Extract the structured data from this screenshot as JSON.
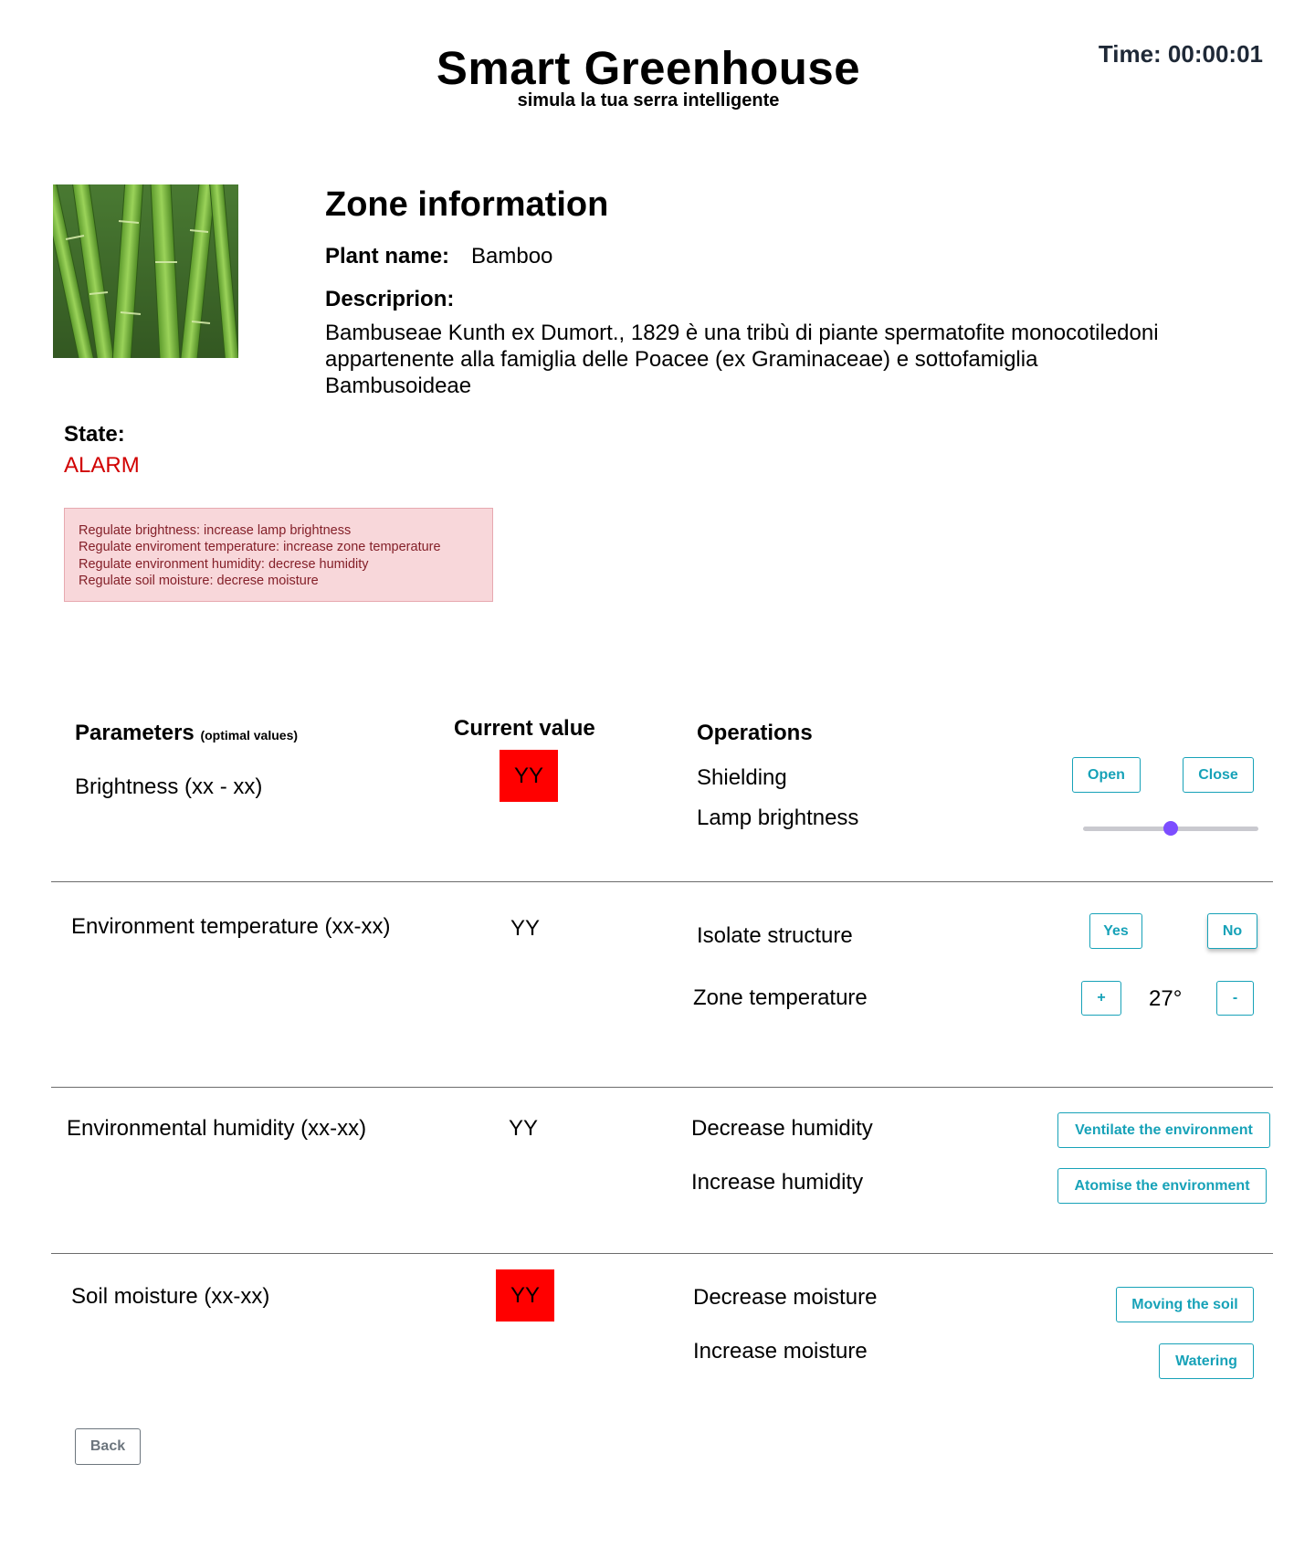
{
  "header": {
    "title": "Smart Greenhouse",
    "subtitle": "simula la tua serra intelligente",
    "timer": "Time: 00:00:01"
  },
  "zone": {
    "title": "Zone information",
    "plant_label": "Plant name:",
    "plant_name": "Bamboo",
    "description_label": "Descriprion:",
    "description": "Bambuseae Kunth ex Dumort., 1829 è una tribù di piante spermatofite monocotiledoni appartenente alla famiglia delle Poacee (ex Graminaceae) e sottofamiglia Bambusoideae"
  },
  "state": {
    "label": "State:",
    "value": "ALARM",
    "color": "#d10000"
  },
  "alert": {
    "lines": [
      "Regulate brightness: increase lamp brightness",
      "Regulate enviroment temperature: increase zone temperature",
      "Regulate environment humidity: decrese humidity",
      "Regulate soil moisture:  decrese moisture"
    ]
  },
  "table": {
    "params_header": "Parameters",
    "params_header_note": "(optimal values)",
    "current_header": "Current value",
    "operations_header": "Operations"
  },
  "rows": {
    "brightness": {
      "param": "Brightness (xx - xx)",
      "value": "YY",
      "alert": true,
      "op1": "Shielding",
      "op1_btn_a": "Open",
      "op1_btn_b": "Close",
      "op2": "Lamp brightness",
      "slider_value": 0.5
    },
    "temperature": {
      "param": "Environment temperature (xx-xx)",
      "value": "YY",
      "alert": false,
      "op1": "Isolate structure",
      "op1_btn_a": "Yes",
      "op1_btn_b": "No",
      "op2": "Zone temperature",
      "plus": "+",
      "minus": "-",
      "temp": "27°"
    },
    "humidity": {
      "param": "Environmental humidity (xx-xx)",
      "value": "YY",
      "alert": false,
      "op1": "Decrease humidity",
      "op1_btn": "Ventilate the environment",
      "op2": "Increase humidity",
      "op2_btn": "Atomise the environment"
    },
    "soil": {
      "param": "Soil moisture (xx-xx)",
      "value": "YY",
      "alert": true,
      "op1": "Decrease moisture",
      "op1_btn": "Moving the soil",
      "op2": "Increase moisture",
      "op2_btn": "Watering"
    }
  },
  "footer": {
    "back_label": "Back"
  },
  "colors": {
    "accent": "#17a2b8",
    "alert_cell": "#ff0000",
    "alert_bg": "#f8d7da",
    "slider_thumb": "#7c4dff"
  }
}
